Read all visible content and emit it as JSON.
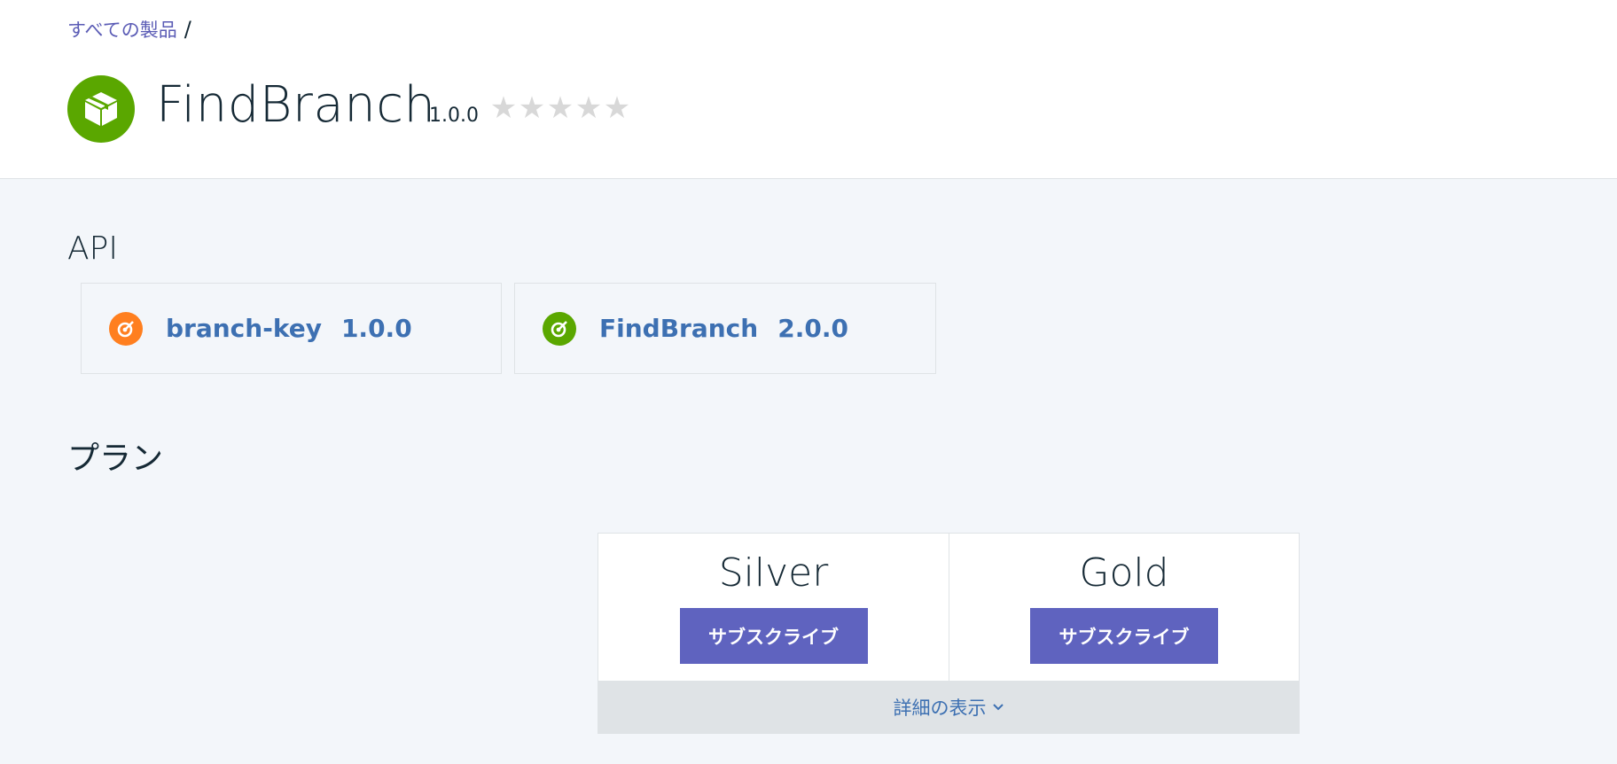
{
  "breadcrumb": {
    "link": "すべての製品",
    "separator": "/"
  },
  "product": {
    "title": "FindBranch",
    "version": "1.0.0",
    "rating": 0,
    "max_rating": 5,
    "icon": "package-icon",
    "icon_color": "#5aa700"
  },
  "api_section": {
    "title": "API",
    "apis": [
      {
        "name": "branch-key",
        "version": "1.0.0",
        "icon": "api-icon",
        "icon_color": "#ff7f1f"
      },
      {
        "name": "FindBranch",
        "version": "2.0.0",
        "icon": "api-icon",
        "icon_color": "#5aa700"
      }
    ]
  },
  "plans_section": {
    "title": "プラン",
    "plans": [
      {
        "name": "Silver",
        "button": "サブスクライブ"
      },
      {
        "name": "Gold",
        "button": "サブスクライブ"
      }
    ],
    "details_label": "詳細の表示",
    "button_color": "#5f63bf"
  }
}
